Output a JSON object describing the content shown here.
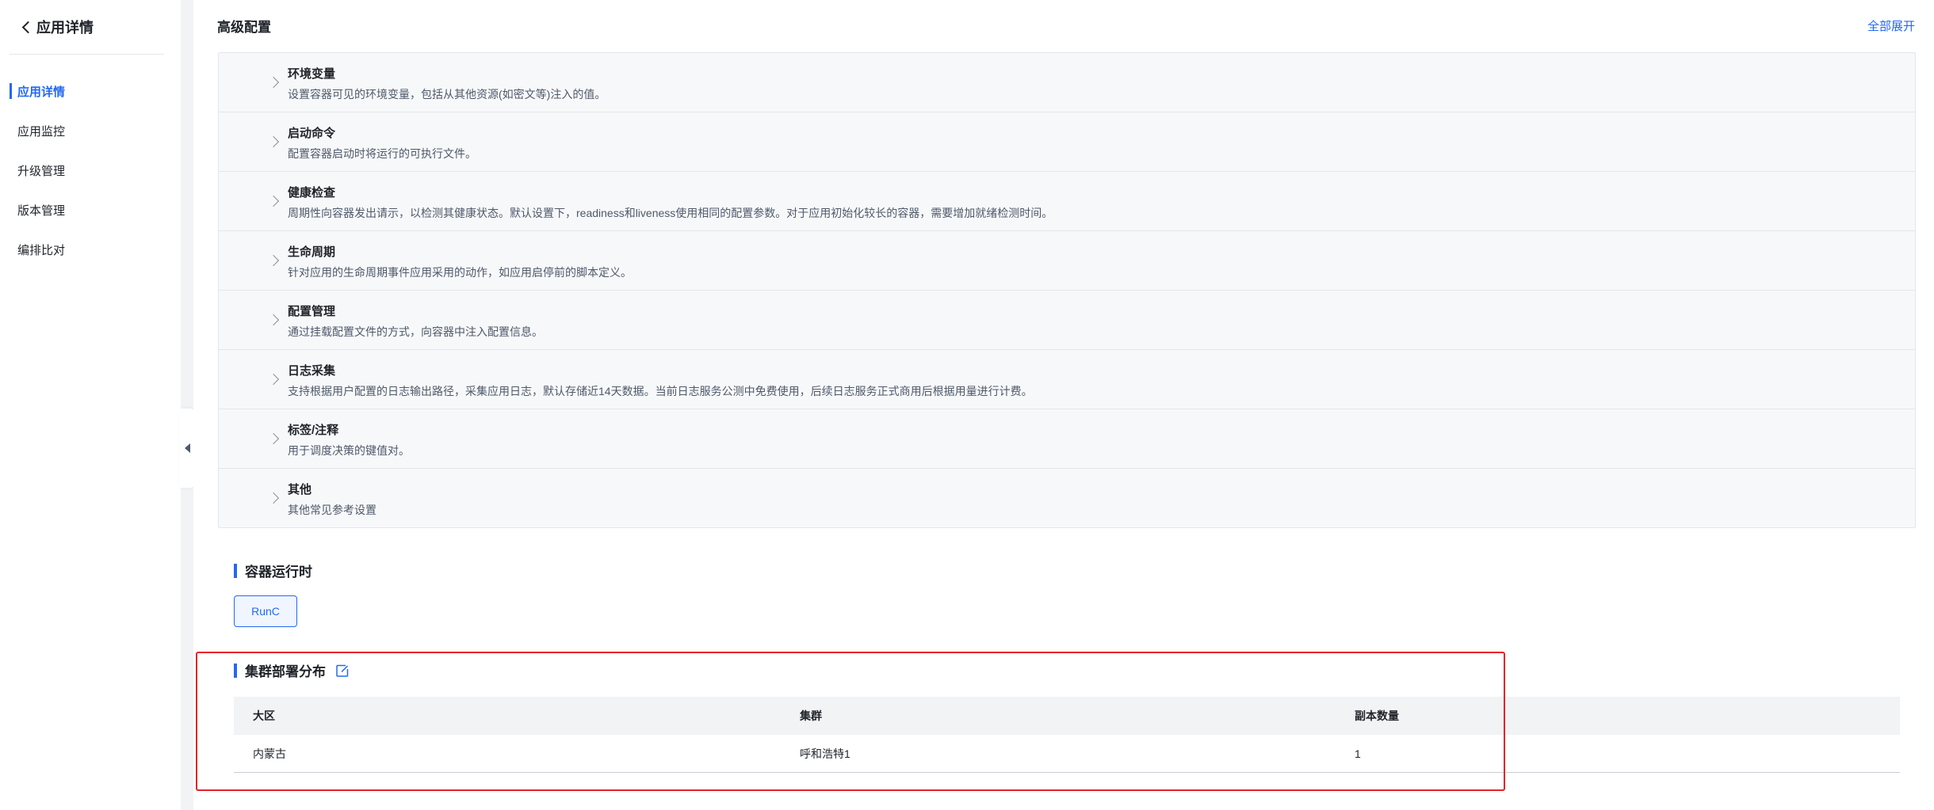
{
  "sidebar": {
    "back_label": "应用详情",
    "items": [
      {
        "label": "应用详情",
        "active": true
      },
      {
        "label": "应用监控"
      },
      {
        "label": "升级管理"
      },
      {
        "label": "版本管理"
      },
      {
        "label": "编排比对"
      }
    ]
  },
  "advanced": {
    "title": "高级配置",
    "expand_all": "全部展开",
    "rows": [
      {
        "title": "环境变量",
        "desc": "设置容器可见的环境变量，包括从其他资源(如密文等)注入的值。"
      },
      {
        "title": "启动命令",
        "desc": "配置容器启动时将运行的可执行文件。"
      },
      {
        "title": "健康检查",
        "desc": "周期性向容器发出请示，以检测其健康状态。默认设置下，readiness和liveness使用相同的配置参数。对于应用初始化较长的容器，需要增加就绪检测时间。"
      },
      {
        "title": "生命周期",
        "desc": "针对应用的生命周期事件应用采用的动作，如应用启停前的脚本定义。"
      },
      {
        "title": "配置管理",
        "desc": "通过挂载配置文件的方式，向容器中注入配置信息。"
      },
      {
        "title": "日志采集",
        "desc": "支持根据用户配置的日志输出路径，采集应用日志，默认存储近14天数据。当前日志服务公测中免费使用，后续日志服务正式商用后根据用量进行计费。"
      },
      {
        "title": "标签/注释",
        "desc": "用于调度决策的键值对。"
      },
      {
        "title": "其他",
        "desc": "其他常见参考设置"
      }
    ]
  },
  "runtime": {
    "title": "容器运行时",
    "value": "RunC"
  },
  "cluster": {
    "title": "集群部署分布",
    "columns": [
      "大区",
      "集群",
      "副本数量"
    ],
    "rows": [
      [
        "内蒙古",
        "呼和浩特1",
        "1"
      ]
    ]
  },
  "colors": {
    "accent": "#2468f2",
    "highlight": "#e6212a"
  }
}
